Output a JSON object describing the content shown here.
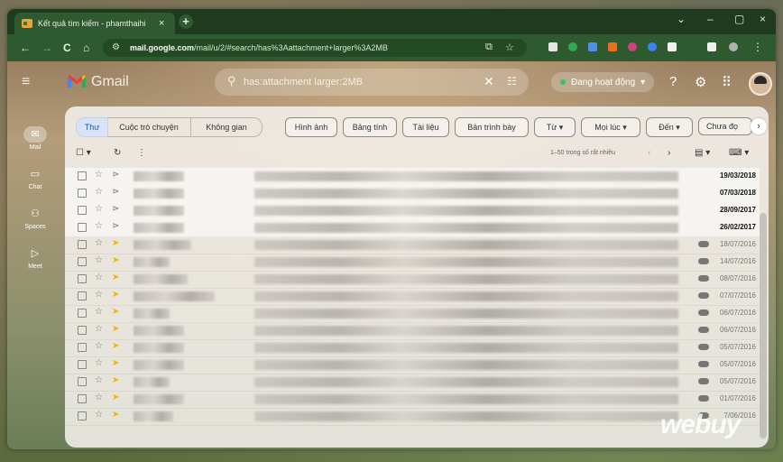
{
  "browser": {
    "tab_title": "Kết quả tìm kiếm - phamthaihi",
    "tab_close": "×",
    "new_tab": "+",
    "url_host": "mail.google.com",
    "url_path": "/mail/u/2/#search/has%3Aattachment+larger%3A2MB",
    "controls": {
      "menu": "⌄",
      "minimize": "–",
      "maximize": "▢",
      "close": "×"
    },
    "nav": {
      "back": "←",
      "forward": "→",
      "reload": "C",
      "home": "⌂"
    }
  },
  "gmail": {
    "logo_text": "Gmail",
    "search_query": "has:attachment larger:2MB",
    "status": "Đang hoạt động",
    "rail": [
      {
        "label": "Mail",
        "icon": "mail-icon"
      },
      {
        "label": "Chat",
        "icon": "chat-icon"
      },
      {
        "label": "Spaces",
        "icon": "spaces-icon"
      },
      {
        "label": "Meet",
        "icon": "meet-icon"
      }
    ],
    "category_tabs": [
      "Thư",
      "Cuộc trò chuyện",
      "Không gian"
    ],
    "chips": [
      "Hình ảnh",
      "Bảng tính",
      "Tài liệu",
      "Bản trình bày",
      "Từ ▾",
      "Mọi lúc ▾",
      "Đến ▾",
      "Chưa đọ"
    ],
    "pagination": "1–50 trong số rất nhiều",
    "rows": [
      {
        "date": "19/03/2018",
        "unread": true,
        "important": false
      },
      {
        "date": "07/03/2018",
        "unread": true,
        "important": false
      },
      {
        "date": "28/09/2017",
        "unread": true,
        "important": false
      },
      {
        "date": "26/02/2017",
        "unread": true,
        "important": false
      },
      {
        "date": "18/07/2016",
        "unread": false,
        "important": true
      },
      {
        "date": "14/07/2016",
        "unread": false,
        "important": true
      },
      {
        "date": "08/07/2016",
        "unread": false,
        "important": true
      },
      {
        "date": "07/07/2016",
        "unread": false,
        "important": true
      },
      {
        "date": "06/07/2016",
        "unread": false,
        "important": true
      },
      {
        "date": "06/07/2016",
        "unread": false,
        "important": true
      },
      {
        "date": "05/07/2016",
        "unread": false,
        "important": true
      },
      {
        "date": "05/07/2016",
        "unread": false,
        "important": true
      },
      {
        "date": "05/07/2016",
        "unread": false,
        "important": true
      },
      {
        "date": "01/07/2016",
        "unread": false,
        "important": true
      },
      {
        "date": "7/06/2016",
        "unread": false,
        "important": true
      }
    ]
  },
  "watermark": "webuy",
  "colors": {
    "chrome_dark": "#1f3a1f",
    "chrome": "#2f5a2f",
    "active_tab_blue": "#1a57c3",
    "important": "#f4b400",
    "online": "#37c26a"
  }
}
